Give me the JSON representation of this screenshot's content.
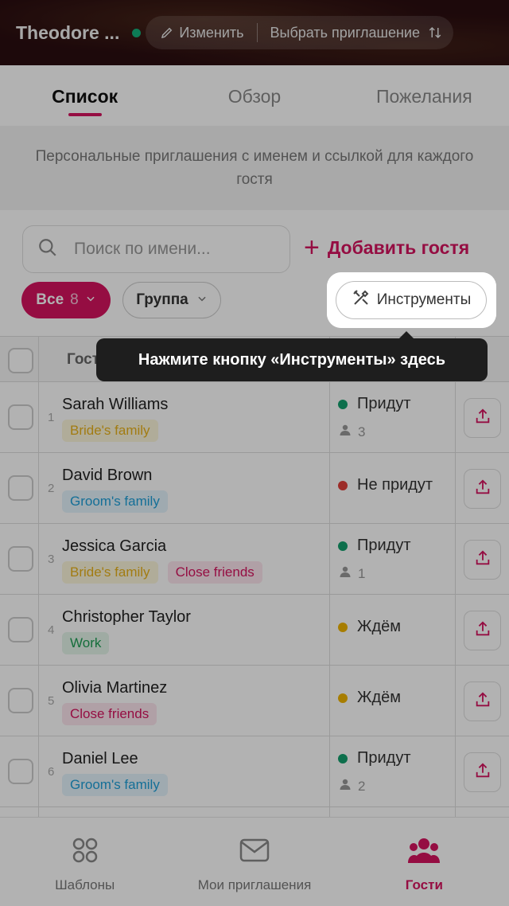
{
  "header": {
    "title": "Theodore ...",
    "edit_label": "Изменить",
    "choose_label": "Выбрать приглашение"
  },
  "tabs": [
    {
      "label": "Список",
      "active": true
    },
    {
      "label": "Обзор",
      "active": false
    },
    {
      "label": "Пожелания",
      "active": false
    }
  ],
  "info_text": "Персональные приглашения с именем и ссылкой для каждого гостя",
  "search": {
    "placeholder": "Поиск по имени..."
  },
  "add_guest_label": "Добавить гостя",
  "filters": {
    "all_label": "Все",
    "all_count": "8",
    "group_label": "Группа"
  },
  "tools_label": "Инструменты",
  "tooltip_text": "Нажмите кнопку «Инструменты» здесь",
  "table": {
    "column_guest": "Гост"
  },
  "guests": [
    {
      "num": "1",
      "name": "Sarah Williams",
      "tags": [
        "Bride's family"
      ],
      "status": "Придут",
      "status_kind": "yes",
      "count": "3"
    },
    {
      "num": "2",
      "name": "David Brown",
      "tags": [
        "Groom's family"
      ],
      "status": "Не придут",
      "status_kind": "no",
      "count": ""
    },
    {
      "num": "3",
      "name": "Jessica Garcia",
      "tags": [
        "Bride's family",
        "Close friends"
      ],
      "status": "Придут",
      "status_kind": "yes",
      "count": "1"
    },
    {
      "num": "4",
      "name": "Christopher Taylor",
      "tags": [
        "Work"
      ],
      "status": "Ждём",
      "status_kind": "wait",
      "count": ""
    },
    {
      "num": "5",
      "name": "Olivia Martinez",
      "tags": [
        "Close friends"
      ],
      "status": "Ждём",
      "status_kind": "wait",
      "count": ""
    },
    {
      "num": "6",
      "name": "Daniel Lee",
      "tags": [
        "Groom's family"
      ],
      "status": "Придут",
      "status_kind": "yes",
      "count": "2"
    }
  ],
  "bottom_nav": [
    {
      "label": "Шаблоны",
      "icon": "templates-icon",
      "active": false
    },
    {
      "label": "Мои приглашения",
      "icon": "envelope-icon",
      "active": false
    },
    {
      "label": "Гости",
      "icon": "guests-icon",
      "active": true
    }
  ],
  "colors": {
    "accent": "#d6145f",
    "status_yes": "#14a06e",
    "status_no": "#e0403a",
    "status_wait": "#f0b400",
    "tag_brides_family": {
      "fg": "#e8b21a",
      "bg": "#fdf6dc"
    },
    "tag_grooms_family": {
      "fg": "#1e9fd9",
      "bg": "#e4f4fc"
    },
    "tag_close_friends": {
      "fg": "#d6145f",
      "bg": "#fce6ee"
    },
    "tag_work": {
      "fg": "#1f9e55",
      "bg": "#e4f5ea"
    }
  }
}
